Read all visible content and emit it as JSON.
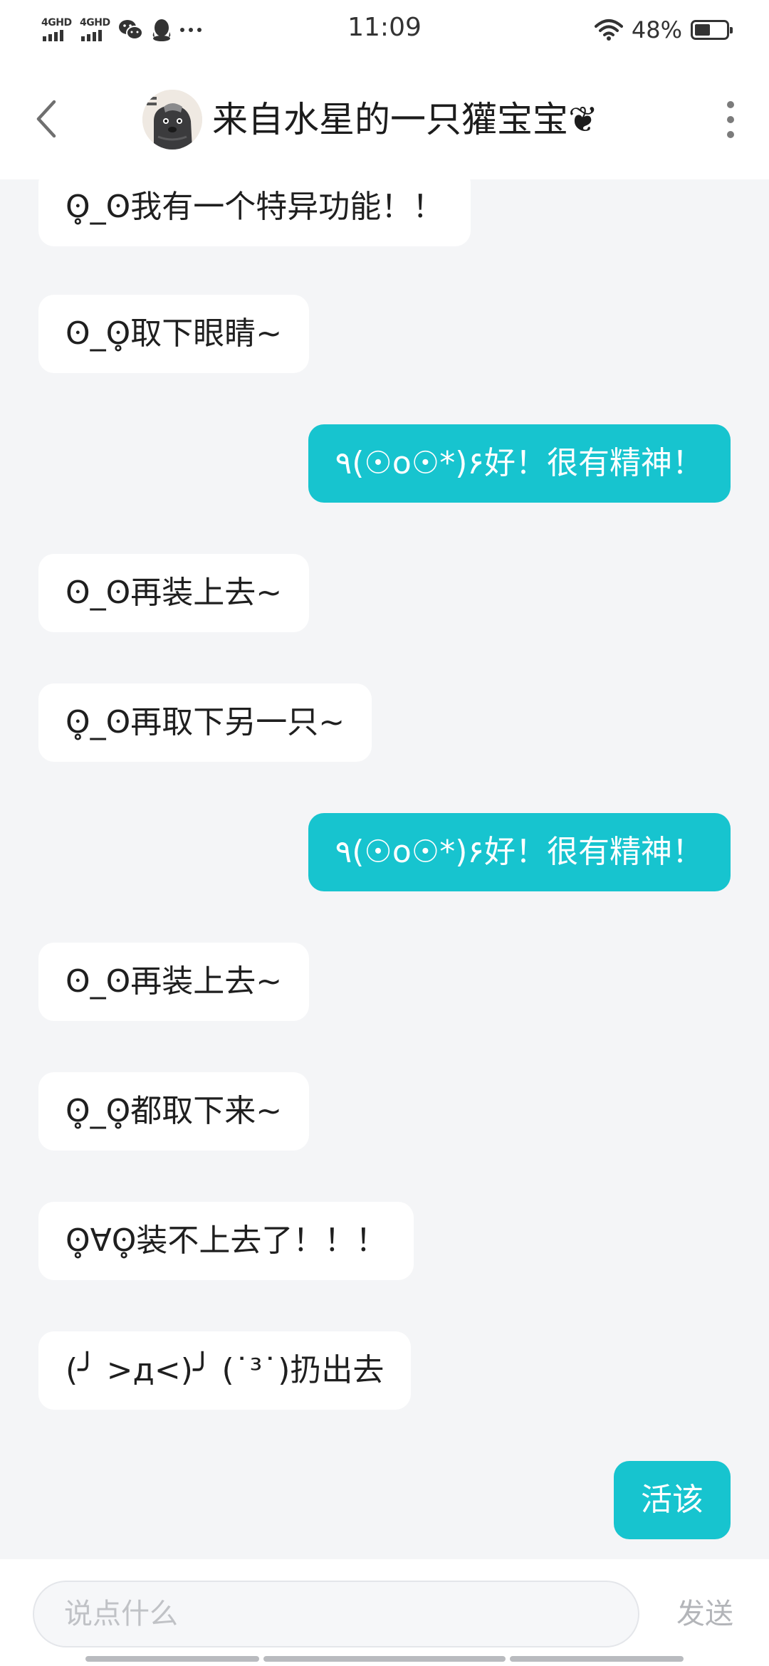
{
  "status_bar": {
    "network_1": "4GHD",
    "network_2": "4GHD",
    "time": "11:09",
    "battery_percent": "48%",
    "battery_level": 0.48,
    "left_icons": [
      "signal-4g-icon",
      "signal-4g-icon",
      "wechat-icon",
      "qq-icon",
      "more-dots-icon"
    ],
    "right_icons": [
      "wifi-icon",
      "battery-icon"
    ]
  },
  "header": {
    "title": "来自水星的一只獾宝宝❦",
    "back_icon": "chevron-left-icon",
    "more_icon": "more-vertical-icon",
    "avatar_icon": "badger-avatar"
  },
  "messages": [
    {
      "side": "in",
      "text": "ʘ̥_ʘ我有一个特异功能！！"
    },
    {
      "side": "in",
      "text": "ʘ_ʘ̥取下眼睛~"
    },
    {
      "side": "out",
      "text": "٩(☉o☉*)۶好！很有精神！"
    },
    {
      "side": "in",
      "text": "ʘ_ʘ再装上去~"
    },
    {
      "side": "in",
      "text": "ʘ̥_ʘ再取下另一只~"
    },
    {
      "side": "out",
      "text": "٩(☉o☉*)۶好！很有精神！"
    },
    {
      "side": "in",
      "text": "ʘ_ʘ再装上去~"
    },
    {
      "side": "in",
      "text": "ʘ̥_ʘ̥都取下来~"
    },
    {
      "side": "in",
      "text": "ʘ̥∀ʘ̥装不上去了！！！"
    },
    {
      "side": "in",
      "text": "(╯ >д<)╯ (˙³˙)扔出去"
    },
    {
      "side": "out",
      "text": "活该"
    }
  ],
  "input": {
    "placeholder": "说点什么",
    "send_label": "发送"
  },
  "colors": {
    "accent": "#17c4cf",
    "background": "#f4f5f7",
    "bubble_in": "#ffffff"
  }
}
